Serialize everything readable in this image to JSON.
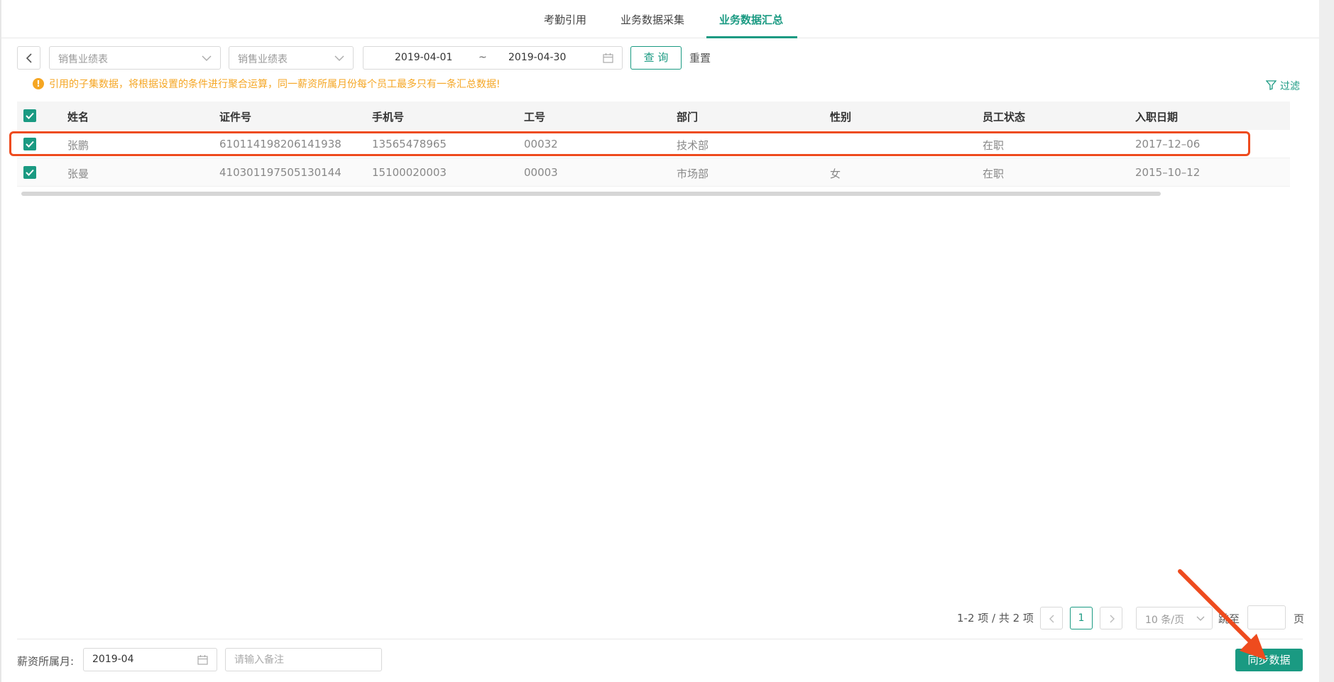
{
  "tabs": [
    {
      "label": "考勤引用",
      "active": false
    },
    {
      "label": "业务数据采集",
      "active": false
    },
    {
      "label": "业务数据汇总",
      "active": true
    }
  ],
  "toolbar": {
    "select1_placeholder": "销售业绩表",
    "select2_placeholder": "销售业绩表",
    "date_start": "2019-04-01",
    "date_separator": "~",
    "date_end": "2019-04-30",
    "query_label": "查 询",
    "reset_label": "重置"
  },
  "warning_text": "引用的子集数据，将根据设置的条件进行聚合运算，同一薪资所属月份每个员工最多只有一条汇总数据!",
  "filter_label": "过滤",
  "table": {
    "columns": [
      "姓名",
      "证件号",
      "手机号",
      "工号",
      "部门",
      "性别",
      "员工状态",
      "入职日期"
    ],
    "rows": [
      {
        "name": "张鹏",
        "id_no": "610114198206141938",
        "phone": "13565478965",
        "emp_no": "00032",
        "dept": "技术部",
        "gender": "",
        "status": "在职",
        "join_date": "2017–12–06",
        "checked": true
      },
      {
        "name": "张曼",
        "id_no": "410301197505130144",
        "phone": "15100020003",
        "emp_no": "00003",
        "dept": "市场部",
        "gender": "女",
        "status": "在职",
        "join_date": "2015–10–12",
        "checked": true
      }
    ]
  },
  "pagination": {
    "info": "1-2 项 / 共 2 项",
    "current_page": "1",
    "page_size": "10 条/页",
    "jump_label": "跳至",
    "page_suffix": "页"
  },
  "footer": {
    "salary_month_label": "薪资所属月:",
    "salary_month_value": "2019-04",
    "note_placeholder": "请输入备注",
    "sync_label": "同步数据"
  },
  "colors": {
    "accent": "#1a9a82",
    "warning": "#f5a623",
    "annotation": "#ee4b1e"
  }
}
